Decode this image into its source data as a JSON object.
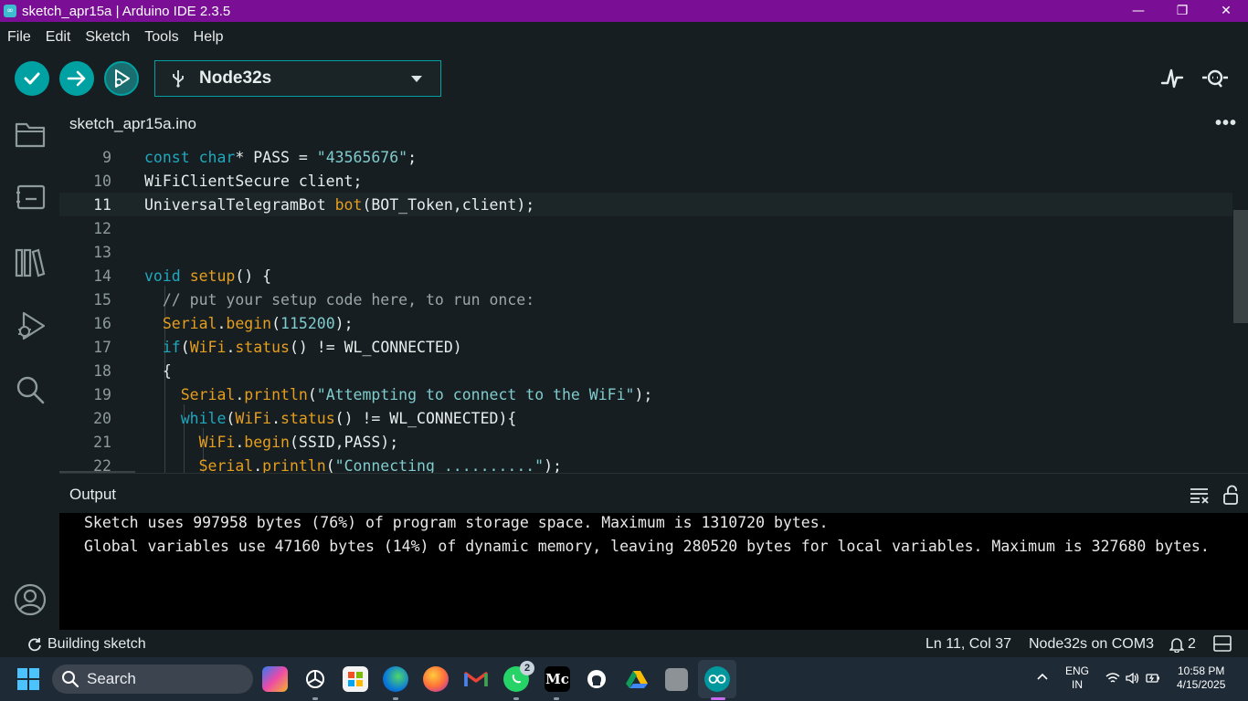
{
  "window": {
    "title": "sketch_apr15a | Arduino IDE 2.3.5",
    "controls": [
      "—",
      "❐",
      "✕"
    ]
  },
  "menu": [
    "File",
    "Edit",
    "Sketch",
    "Tools",
    "Help"
  ],
  "toolbar": {
    "verify_icon": "checkmark-icon",
    "upload_icon": "arrow-right-icon",
    "debug_icon": "debug-icon",
    "board": "Node32s",
    "serial_plotter_icon": "pulse-icon",
    "serial_monitor_icon": "magnifier-icon"
  },
  "sidebar": [
    "folder-icon",
    "board-manager-icon",
    "library-icon",
    "debug-icon",
    "search-icon",
    "account-icon"
  ],
  "tabs": {
    "active": "sketch_apr15a.ino",
    "more": "•••"
  },
  "editor": {
    "current_line": 11,
    "lines": [
      {
        "n": "9",
        "html": "<span class='kw'>const</span> <span class='kw'>char</span>* PASS = <span class='str'>\"43565676\"</span>;"
      },
      {
        "n": "10",
        "html": "WiFiClientSecure client;"
      },
      {
        "n": "11",
        "html": "UniversalTelegramBot <span class='fn'>bot</span>(BOT_Token,client);"
      },
      {
        "n": "12",
        "html": ""
      },
      {
        "n": "13",
        "html": ""
      },
      {
        "n": "14",
        "html": "<span class='kw'>void</span> <span class='fn'>setup</span>() {"
      },
      {
        "n": "15",
        "html": "  <span class='cm'>// put your setup code here, to run once:</span>"
      },
      {
        "n": "16",
        "html": "  <span class='fn'>Serial</span>.<span class='fn'>begin</span>(<span class='num'>115200</span>);"
      },
      {
        "n": "17",
        "html": "  <span class='kw'>if</span>(<span class='fn'>WiFi</span>.<span class='fn'>status</span>() != WL_CONNECTED)"
      },
      {
        "n": "18",
        "html": "  {"
      },
      {
        "n": "19",
        "html": "    <span class='fn'>Serial</span>.<span class='fn'>println</span>(<span class='str'>\"Attempting to connect to the WiFi\"</span>);"
      },
      {
        "n": "20",
        "html": "    <span class='kw'>while</span>(<span class='fn'>WiFi</span>.<span class='fn'>status</span>() != WL_CONNECTED){"
      },
      {
        "n": "21",
        "html": "      <span class='fn'>WiFi</span>.<span class='fn'>begin</span>(SSID,PASS);"
      },
      {
        "n": "22",
        "html": "      <span class='fn'>Serial</span>.<span class='fn'>println</span>(<span class='str'>\"Connecting ..........\"</span>);"
      }
    ]
  },
  "output": {
    "title": "Output",
    "lines": [
      "Sketch uses 997958 bytes (76%) of program storage space. Maximum is 1310720 bytes.",
      "Global variables use 47160 bytes (14%) of dynamic memory, leaving 280520 bytes for local variables. Maximum is 327680 bytes."
    ]
  },
  "status": {
    "building": "Building sketch",
    "position": "Ln 11, Col 37",
    "board_port": "Node32s on COM3",
    "notifications": "2"
  },
  "taskbar": {
    "search": "Search",
    "whatsapp_badge": "2",
    "medium_label": "Mc",
    "lang_top": "ENG",
    "lang_bottom": "IN",
    "time": "10:58 PM",
    "date": "4/15/2025"
  }
}
